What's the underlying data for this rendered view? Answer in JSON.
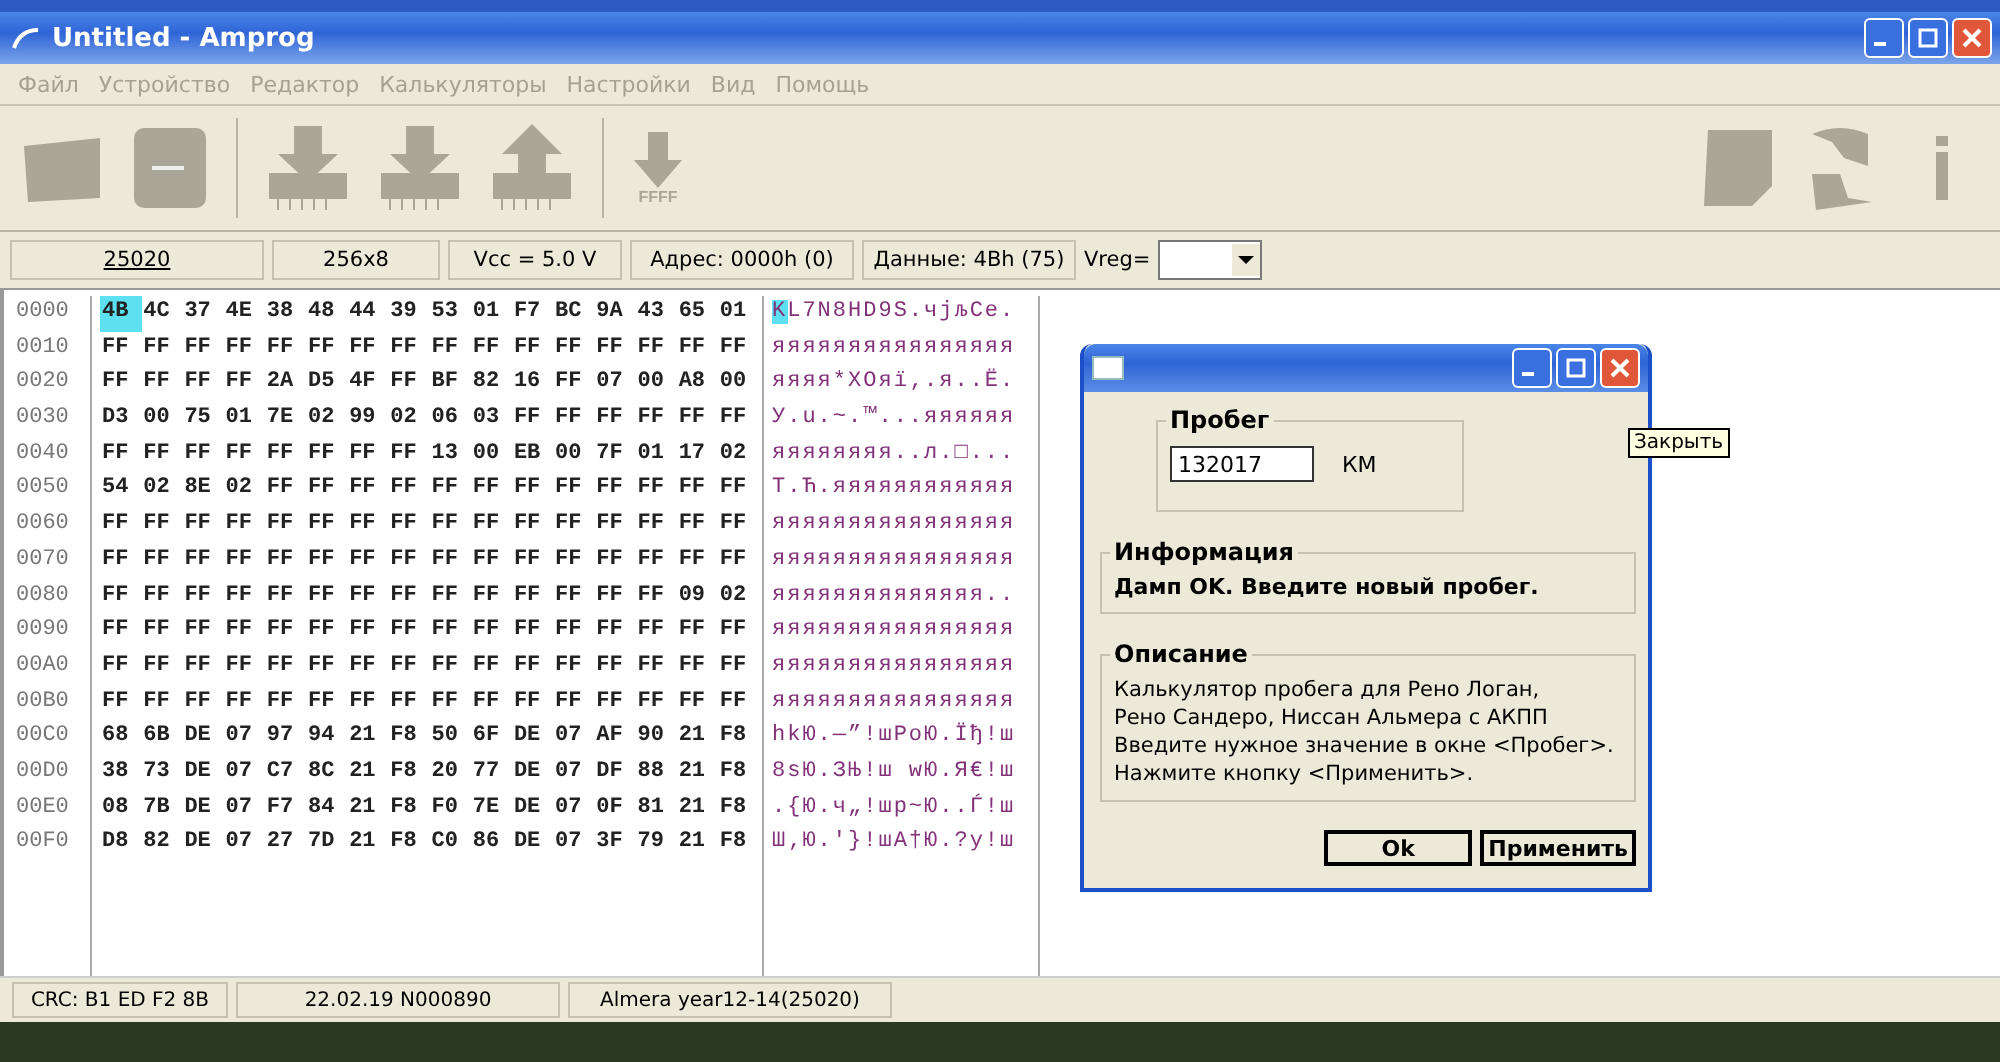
{
  "window": {
    "title": "Untitled - Amprog"
  },
  "menu": [
    {
      "label": "Файл",
      "disabled": true
    },
    {
      "label": "Устройство",
      "disabled": true
    },
    {
      "label": "Редактор",
      "disabled": true
    },
    {
      "label": "Калькуляторы",
      "disabled": true
    },
    {
      "label": "Настройки",
      "disabled": true
    },
    {
      "label": "Вид",
      "disabled": true
    },
    {
      "label": "Помощь",
      "disabled": true
    }
  ],
  "toolbar": {
    "erase_label": "FFFF"
  },
  "info_bar": {
    "device": "25020",
    "size": "256x8",
    "vcc": "Vcc = 5.0 V",
    "address": "Адрес: 0000h (0)",
    "data": "Данные: 4Bh (75)",
    "vreg_label": "Vreg="
  },
  "hex_view": {
    "rows": [
      {
        "address": "0000",
        "selected": true,
        "bytes": [
          "4B",
          "4C",
          "37",
          "4E",
          "38",
          "48",
          "44",
          "39",
          "53",
          "01",
          "F7",
          "BC",
          "9A",
          "43",
          "65",
          "01"
        ],
        "ascii": "KL7N8HD9S.чјљCe."
      },
      {
        "address": "0010",
        "selected": false,
        "bytes": [
          "FF",
          "FF",
          "FF",
          "FF",
          "FF",
          "FF",
          "FF",
          "FF",
          "FF",
          "FF",
          "FF",
          "FF",
          "FF",
          "FF",
          "FF",
          "FF"
        ],
        "ascii": "яяяяяяяяяяяяяяяя"
      },
      {
        "address": "0020",
        "selected": false,
        "bytes": [
          "FF",
          "FF",
          "FF",
          "FF",
          "2A",
          "D5",
          "4F",
          "FF",
          "BF",
          "82",
          "16",
          "FF",
          "07",
          "00",
          "A8",
          "00"
        ],
        "ascii": "яяяя*ХOяї‚.я..Ё."
      },
      {
        "address": "0030",
        "selected": false,
        "bytes": [
          "D3",
          "00",
          "75",
          "01",
          "7E",
          "02",
          "99",
          "02",
          "06",
          "03",
          "FF",
          "FF",
          "FF",
          "FF",
          "FF",
          "FF"
        ],
        "ascii": "У.u.~.™...яяяяяя"
      },
      {
        "address": "0040",
        "selected": false,
        "bytes": [
          "FF",
          "FF",
          "FF",
          "FF",
          "FF",
          "FF",
          "FF",
          "FF",
          "13",
          "00",
          "EB",
          "00",
          "7F",
          "01",
          "17",
          "02"
        ],
        "ascii": "яяяяяяяя..л.□..."
      },
      {
        "address": "0050",
        "selected": false,
        "bytes": [
          "54",
          "02",
          "8E",
          "02",
          "FF",
          "FF",
          "FF",
          "FF",
          "FF",
          "FF",
          "FF",
          "FF",
          "FF",
          "FF",
          "FF",
          "FF"
        ],
        "ascii": "T.Ћ.яяяяяяяяяяяя"
      },
      {
        "address": "0060",
        "selected": false,
        "bytes": [
          "FF",
          "FF",
          "FF",
          "FF",
          "FF",
          "FF",
          "FF",
          "FF",
          "FF",
          "FF",
          "FF",
          "FF",
          "FF",
          "FF",
          "FF",
          "FF"
        ],
        "ascii": "яяяяяяяяяяяяяяяя"
      },
      {
        "address": "0070",
        "selected": false,
        "bytes": [
          "FF",
          "FF",
          "FF",
          "FF",
          "FF",
          "FF",
          "FF",
          "FF",
          "FF",
          "FF",
          "FF",
          "FF",
          "FF",
          "FF",
          "FF",
          "FF"
        ],
        "ascii": "яяяяяяяяяяяяяяяя"
      },
      {
        "address": "0080",
        "selected": false,
        "bytes": [
          "FF",
          "FF",
          "FF",
          "FF",
          "FF",
          "FF",
          "FF",
          "FF",
          "FF",
          "FF",
          "FF",
          "FF",
          "FF",
          "FF",
          "09",
          "02"
        ],
        "ascii": "яяяяяяяяяяяяяя.."
      },
      {
        "address": "0090",
        "selected": false,
        "bytes": [
          "FF",
          "FF",
          "FF",
          "FF",
          "FF",
          "FF",
          "FF",
          "FF",
          "FF",
          "FF",
          "FF",
          "FF",
          "FF",
          "FF",
          "FF",
          "FF"
        ],
        "ascii": "яяяяяяяяяяяяяяяя"
      },
      {
        "address": "00A0",
        "selected": false,
        "bytes": [
          "FF",
          "FF",
          "FF",
          "FF",
          "FF",
          "FF",
          "FF",
          "FF",
          "FF",
          "FF",
          "FF",
          "FF",
          "FF",
          "FF",
          "FF",
          "FF"
        ],
        "ascii": "яяяяяяяяяяяяяяяя"
      },
      {
        "address": "00B0",
        "selected": false,
        "bytes": [
          "FF",
          "FF",
          "FF",
          "FF",
          "FF",
          "FF",
          "FF",
          "FF",
          "FF",
          "FF",
          "FF",
          "FF",
          "FF",
          "FF",
          "FF",
          "FF"
        ],
        "ascii": "яяяяяяяяяяяяяяяя"
      },
      {
        "address": "00C0",
        "selected": false,
        "bytes": [
          "68",
          "6B",
          "DE",
          "07",
          "97",
          "94",
          "21",
          "F8",
          "50",
          "6F",
          "DE",
          "07",
          "AF",
          "90",
          "21",
          "F8"
        ],
        "ascii": "hkЮ.—”!шPoЮ.Їђ!ш"
      },
      {
        "address": "00D0",
        "selected": false,
        "bytes": [
          "38",
          "73",
          "DE",
          "07",
          "C7",
          "8C",
          "21",
          "F8",
          "20",
          "77",
          "DE",
          "07",
          "DF",
          "88",
          "21",
          "F8"
        ],
        "ascii": "8sЮ.ЗЊ!ш wЮ.Я€!ш"
      },
      {
        "address": "00E0",
        "selected": false,
        "bytes": [
          "08",
          "7B",
          "DE",
          "07",
          "F7",
          "84",
          "21",
          "F8",
          "F0",
          "7E",
          "DE",
          "07",
          "0F",
          "81",
          "21",
          "F8"
        ],
        "ascii": ".{Ю.ч„!шр~Ю..Ѓ!ш"
      },
      {
        "address": "00F0",
        "selected": false,
        "bytes": [
          "D8",
          "82",
          "DE",
          "07",
          "27",
          "7D",
          "21",
          "F8",
          "C0",
          "86",
          "DE",
          "07",
          "3F",
          "79",
          "21",
          "F8"
        ],
        "ascii": "Ш‚Ю.'}!шА†Ю.?y!ш"
      }
    ]
  },
  "dialog": {
    "mileage_group": "Пробег",
    "mileage_value": "132017",
    "unit": "КМ",
    "info_group": "Информация",
    "info_text": "Дамп OK. Введите новый пробег.",
    "description_group": "Описание",
    "description_lines": [
      "Калькулятор пробега для Рено Логан,",
      "Рено Сандеро, Ниссан Альмера с АКПП",
      "Введите нужное значение в окне <Пробег>.",
      "Нажмите кнопку <Применить>."
    ],
    "buttons": [
      "Ok",
      "Применить"
    ],
    "tooltip": "Закрыть"
  },
  "status_bar": [
    "CRC: B1 ED F2 8B",
    "22.02.19 N000890",
    "Almera year12-14(25020)"
  ]
}
